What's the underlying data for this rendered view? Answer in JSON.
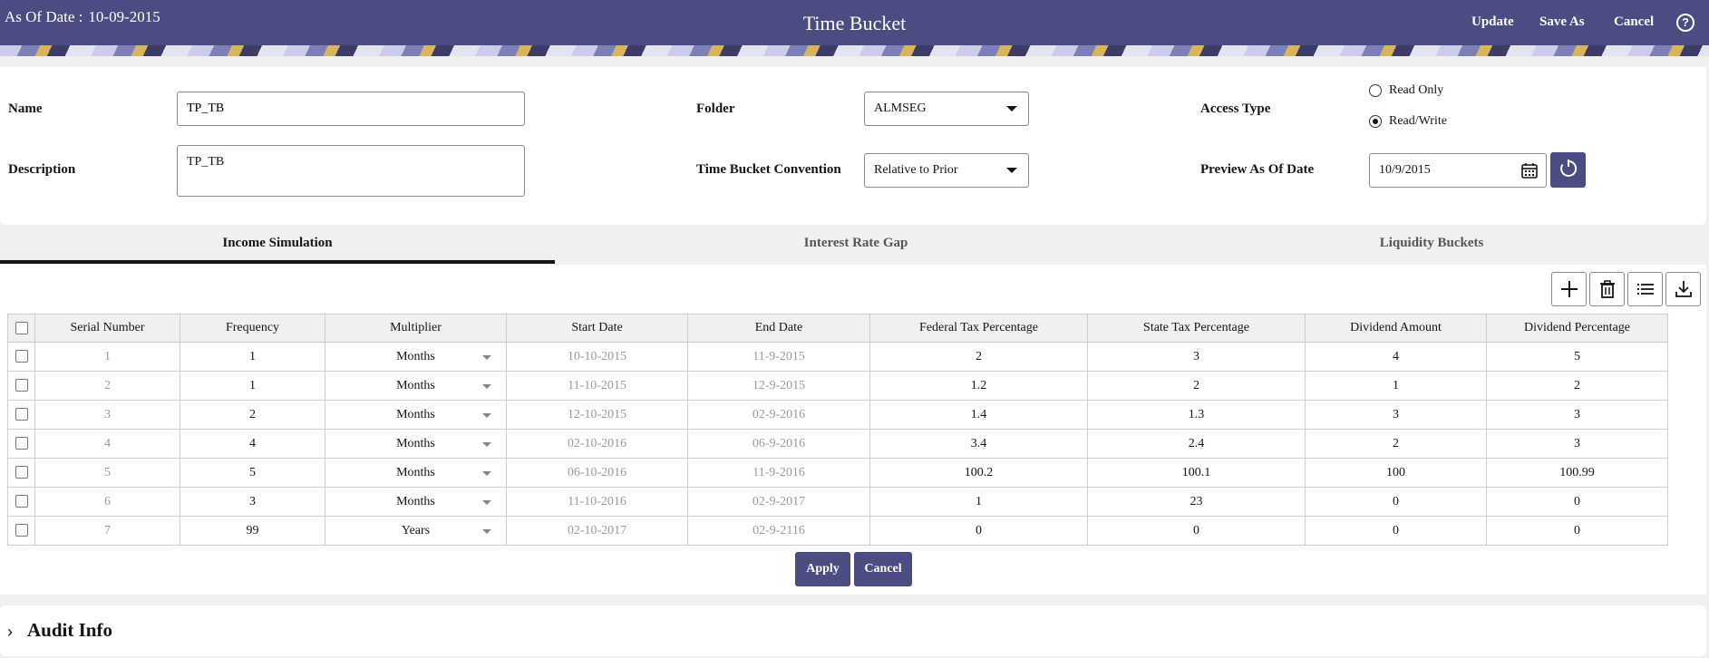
{
  "header": {
    "as_of_label": "As Of Date :",
    "as_of_value": "10-09-2015",
    "title": "Time Bucket",
    "update_label": "Update",
    "save_as_label": "Save As",
    "cancel_label": "Cancel",
    "help_symbol": "?"
  },
  "form": {
    "name_label": "Name",
    "name_value": "TP_TB",
    "description_label": "Description",
    "description_value": "TP_TB",
    "folder_label": "Folder",
    "folder_value": "ALMSEG",
    "convention_label": "Time Bucket Convention",
    "convention_value": "Relative to Prior",
    "access_label": "Access Type",
    "access_options": [
      "Read Only",
      "Read/Write"
    ],
    "access_selected": "Read/Write",
    "preview_label": "Preview As Of Date",
    "preview_value": "10/9/2015"
  },
  "tabs": [
    {
      "label": "Income Simulation",
      "active": true
    },
    {
      "label": "Interest Rate Gap",
      "active": false
    },
    {
      "label": "Liquidity Buckets",
      "active": false
    }
  ],
  "table": {
    "columns": [
      "Serial Number",
      "Frequency",
      "Multiplier",
      "Start Date",
      "End Date",
      "Federal Tax Percentage",
      "State Tax Percentage",
      "Dividend Amount",
      "Dividend Percentage"
    ],
    "rows": [
      [
        "1",
        "1",
        "Months",
        "10-10-2015",
        "11-9-2015",
        "2",
        "3",
        "4",
        "5"
      ],
      [
        "2",
        "1",
        "Months",
        "11-10-2015",
        "12-9-2015",
        "1.2",
        "2",
        "1",
        "2"
      ],
      [
        "3",
        "2",
        "Months",
        "12-10-2015",
        "02-9-2016",
        "1.4",
        "1.3",
        "3",
        "3"
      ],
      [
        "4",
        "4",
        "Months",
        "02-10-2016",
        "06-9-2016",
        "3.4",
        "2.4",
        "2",
        "3"
      ],
      [
        "5",
        "5",
        "Months",
        "06-10-2016",
        "11-9-2016",
        "100.2",
        "100.1",
        "100",
        "100.99"
      ],
      [
        "6",
        "3",
        "Months",
        "11-10-2016",
        "02-9-2017",
        "1",
        "23",
        "0",
        "0"
      ],
      [
        "7",
        "99",
        "Years",
        "02-10-2017",
        "02-9-2116",
        "0",
        "0",
        "0",
        "0"
      ]
    ]
  },
  "actions": {
    "apply_label": "Apply",
    "cancel_label": "Cancel"
  },
  "audit": {
    "title": "Audit Info"
  },
  "colors": {
    "brand": "#4a4c82",
    "background": "#f1f0ee"
  },
  "icons": [
    "plus-icon",
    "trash-icon",
    "list-icon",
    "download-icon",
    "calendar-icon",
    "refresh-icon",
    "chevron-right-icon",
    "help-icon"
  ]
}
